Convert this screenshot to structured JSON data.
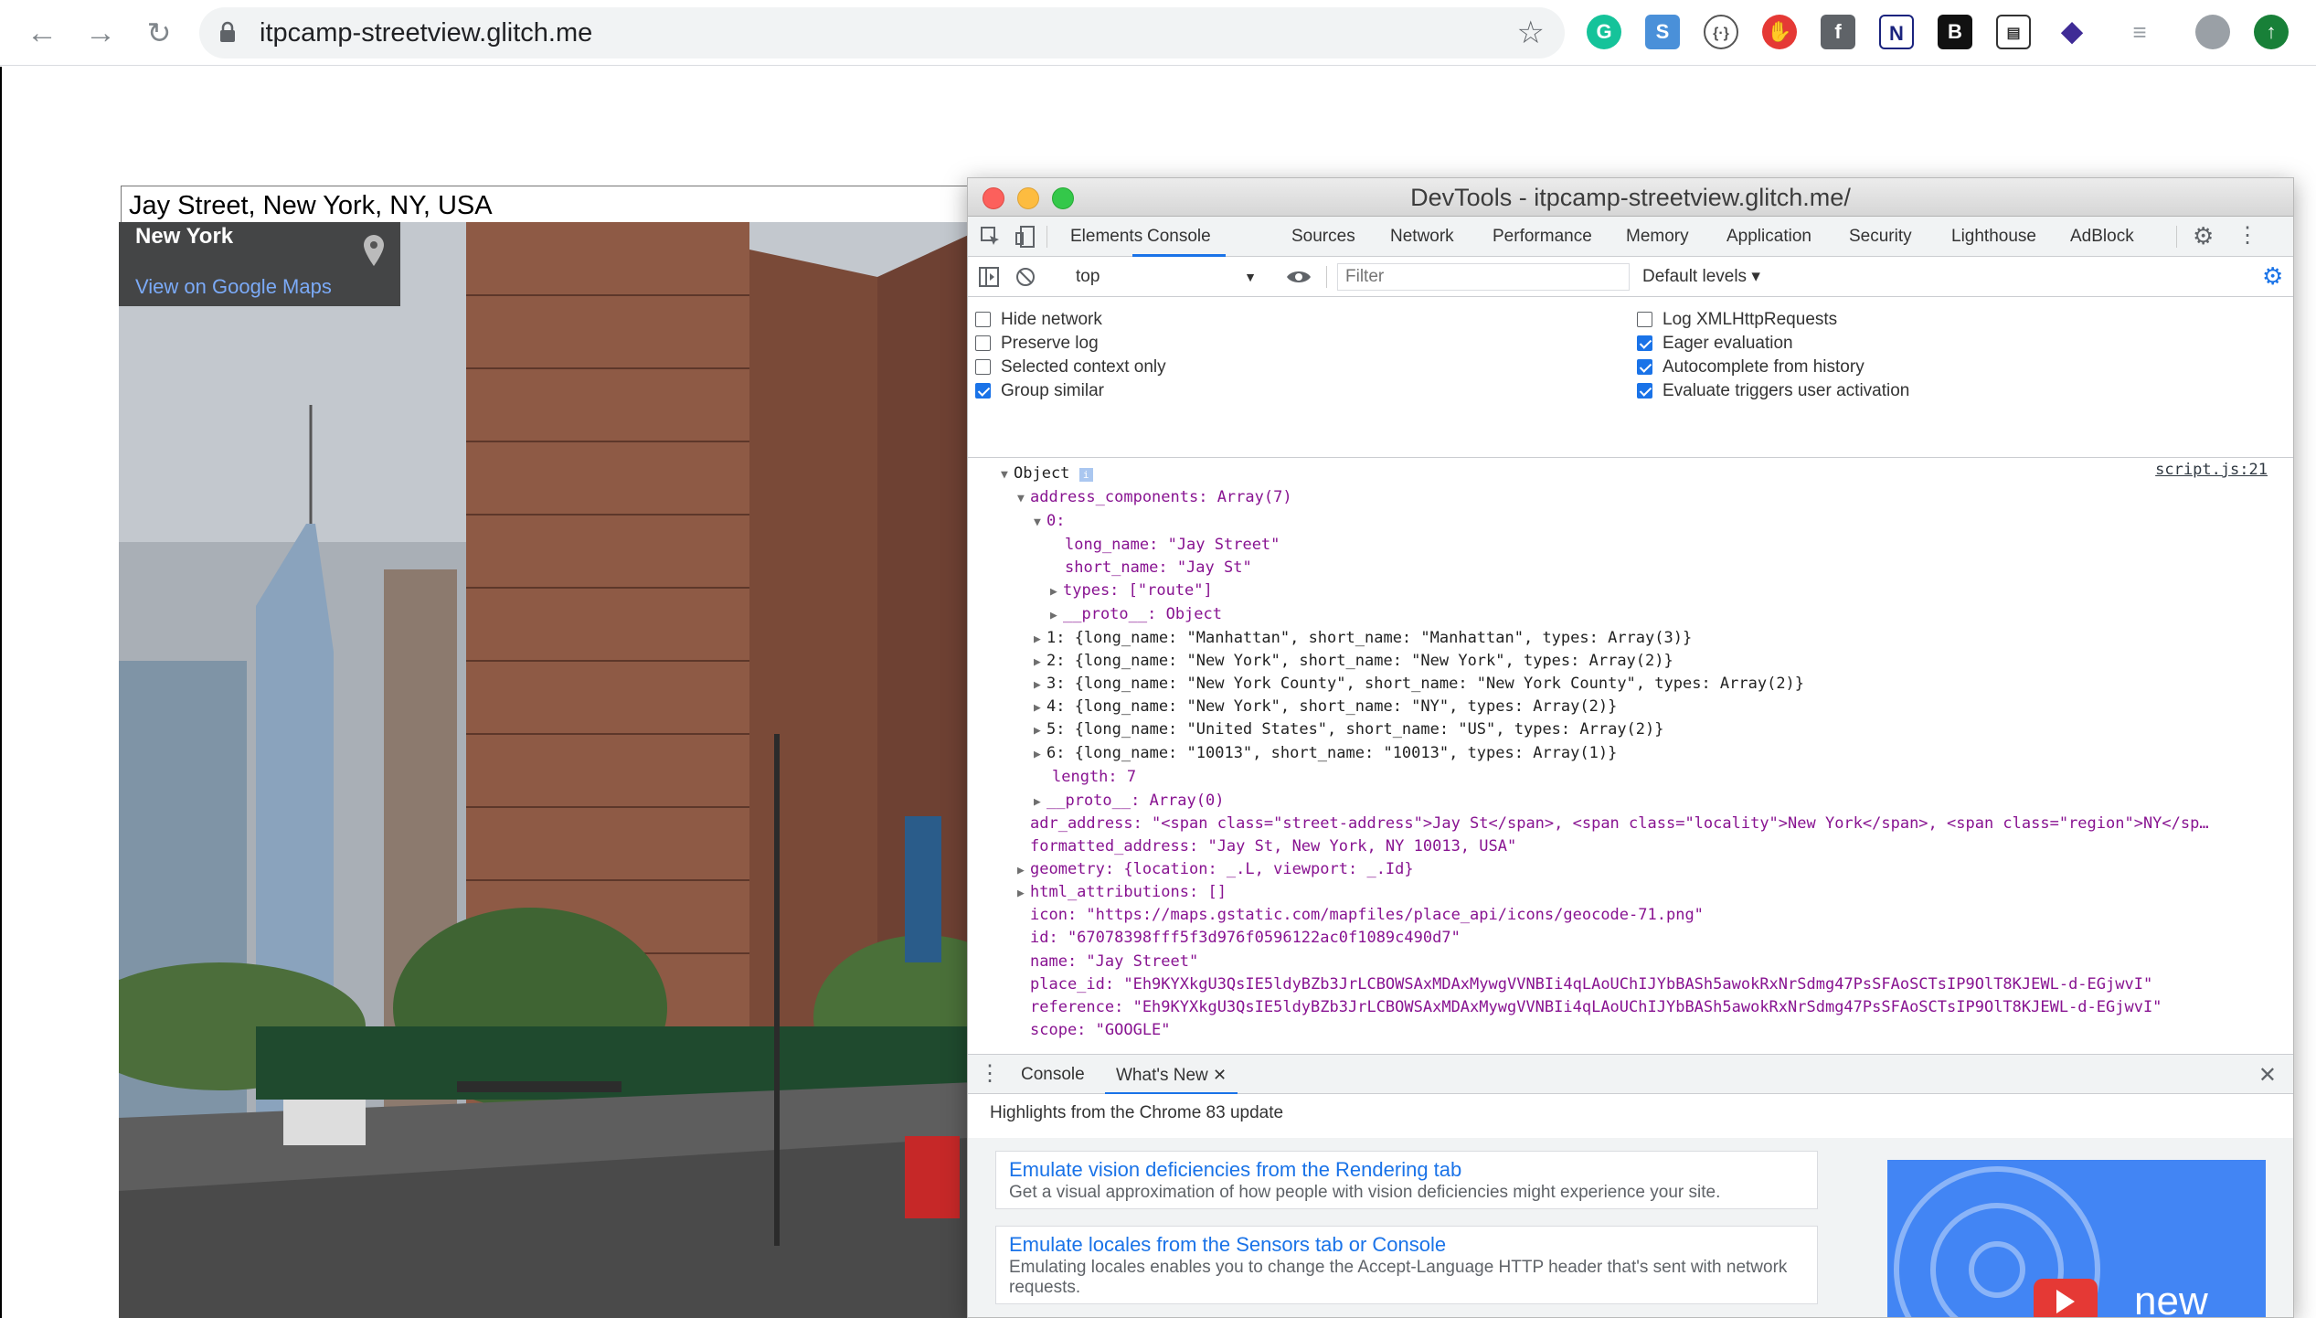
{
  "browser": {
    "url": "itpcamp-streetview.glitch.me",
    "extensions": [
      "grammarly-icon",
      "s-extension-icon",
      "code-icon",
      "stop-icon",
      "facebook-icon",
      "n-extension-icon",
      "b-extension-icon",
      "news-icon",
      "layers-icon"
    ]
  },
  "page": {
    "address_value": "Jay Street, New York, NY, USA",
    "streetview": {
      "card_title": "New York",
      "card_link": "View on Google Maps"
    }
  },
  "devtools": {
    "title": "DevTools - itpcamp-streetview.glitch.me/",
    "tabs": [
      "Elements",
      "Console",
      "Sources",
      "Network",
      "Performance",
      "Memory",
      "Application",
      "Security",
      "Lighthouse",
      "AdBlock"
    ],
    "active_tab": "Console",
    "toolbar": {
      "context": "top",
      "filter_placeholder": "Filter",
      "levels": "Default levels ▾"
    },
    "settings_left": [
      {
        "label": "Hide network",
        "checked": false
      },
      {
        "label": "Preserve log",
        "checked": false
      },
      {
        "label": "Selected context only",
        "checked": false
      },
      {
        "label": "Group similar",
        "checked": true
      }
    ],
    "settings_right": [
      {
        "label": "Log XMLHttpRequests",
        "checked": false
      },
      {
        "label": "Eager evaluation",
        "checked": true
      },
      {
        "label": "Autocomplete from history",
        "checked": true
      },
      {
        "label": "Evaluate triggers user activation",
        "checked": true
      }
    ],
    "console": {
      "source_ref": "script.js:21",
      "lines": [
        "Object",
        "address_components: Array(7)",
        "0:",
        "long_name: \"Jay Street\"",
        "short_name: \"Jay St\"",
        "types: [\"route\"]",
        "__proto__: Object",
        "1: {long_name: \"Manhattan\", short_name: \"Manhattan\", types: Array(3)}",
        "2: {long_name: \"New York\", short_name: \"New York\", types: Array(2)}",
        "3: {long_name: \"New York County\", short_name: \"New York County\", types: Array(2)}",
        "4: {long_name: \"New York\", short_name: \"NY\", types: Array(2)}",
        "5: {long_name: \"United States\", short_name: \"US\", types: Array(2)}",
        "6: {long_name: \"10013\", short_name: \"10013\", types: Array(1)}",
        "length: 7",
        "__proto__: Array(0)",
        "adr_address: \"<span class=\"street-address\">Jay St</span>, <span class=\"locality\">New York</span>, <span class=\"region\">NY</sp…",
        "formatted_address: \"Jay St, New York, NY 10013, USA\"",
        "geometry: {location: _.L, viewport: _.Id}",
        "html_attributions: []",
        "icon: \"https://maps.gstatic.com/mapfiles/place_api/icons/geocode-71.png\"",
        "id: \"67078398fff5f3d976f0596122ac0f1089c490d7\"",
        "name: \"Jay Street\"",
        "place_id: \"Eh9KYXkgU3QsIE5ldyBZb3JrLCBOWSAxMDAxMywgVVNBIi4qLAoUChIJYbBASh5awokRxNrSdmg47PsSFAoSCTsIP9OlT8KJEWL-d-EGjwvI\"",
        "reference: \"Eh9KYXkgU3QsIE5ldyBZb3JrLCBOWSAxMDAxMywgVVNBIi4qLAoUChIJYbBASh5awokRxNrSdmg47PsSFAoSCTsIP9OlT8KJEWL-d-EGjwvI\"",
        "scope: \"GOOGLE\""
      ]
    },
    "drawer": {
      "tabs": [
        "Console",
        "What's New"
      ],
      "active": "What's New",
      "header": "Highlights from the Chrome 83 update",
      "cards": [
        {
          "title": "Emulate vision deficiencies from the Rendering tab",
          "desc": "Get a visual approximation of how people with vision deficiencies might experience your site."
        },
        {
          "title": "Emulate locales from the Sensors tab or Console",
          "desc": "Emulating locales enables you to change the Accept-Language HTTP header that's sent with network requests."
        }
      ],
      "promo_text": "new"
    }
  }
}
